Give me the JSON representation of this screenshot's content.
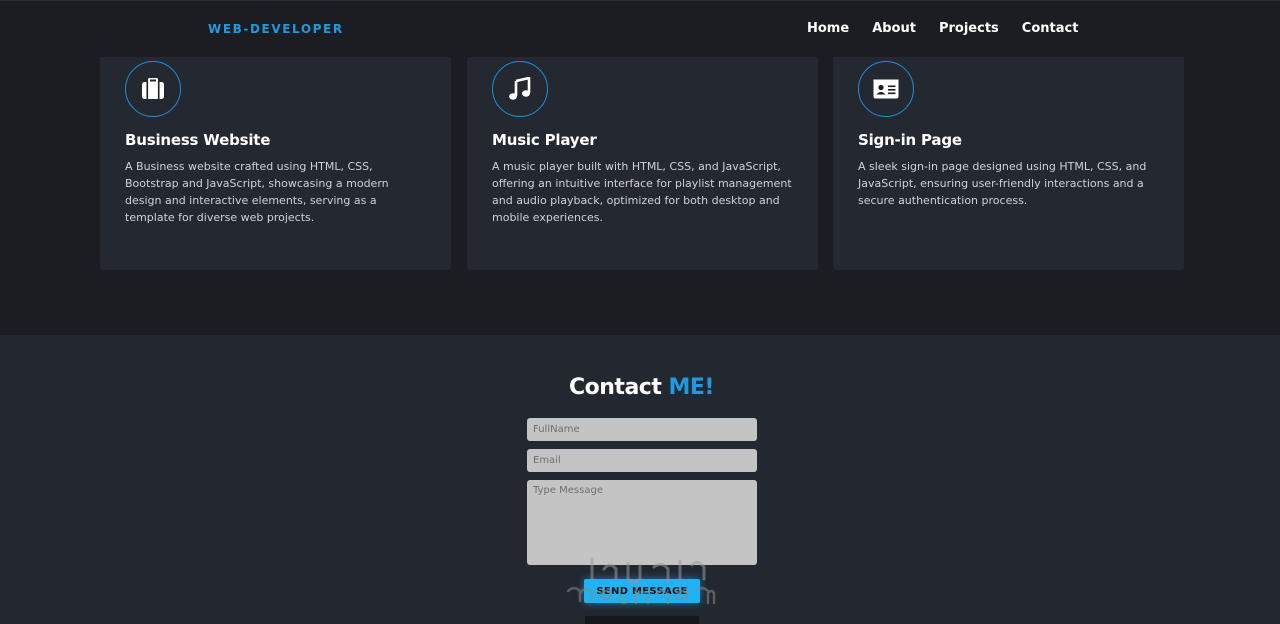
{
  "navbar": {
    "logo": "WEB-DEVELOPER",
    "links": [
      "Home",
      "About",
      "Projects",
      "Contact"
    ]
  },
  "projects": [
    {
      "icon": "briefcase-icon",
      "title": "Business Website",
      "description": "A Business website crafted using HTML, CSS, Bootstrap and JavaScript, showcasing a modern design and interactive elements, serving as a template for diverse web projects."
    },
    {
      "icon": "music-note-icon",
      "title": "Music Player",
      "description": "A music player built with HTML, CSS, and JavaScript, offering an intuitive interface for playlist management and audio playback, optimized for both desktop and mobile experiences."
    },
    {
      "icon": "id-card-icon",
      "title": "Sign-in Page",
      "description": "A sleek sign-in page designed using HTML, CSS, and JavaScript, ensuring user-friendly interactions and a secure authentication process."
    }
  ],
  "contact": {
    "title_main": "Contact ",
    "title_accent": "ME!",
    "fullname_placeholder": "FullName",
    "email_placeholder": "Email",
    "message_placeholder": "Type Message",
    "send_label": "SEND MESSAGE"
  },
  "colors": {
    "accent": "#1e9be0",
    "button": "#1fb2f5",
    "nav_bg": "#1b1d22",
    "card_bg": "#242831",
    "contact_bg": "#222730"
  }
}
